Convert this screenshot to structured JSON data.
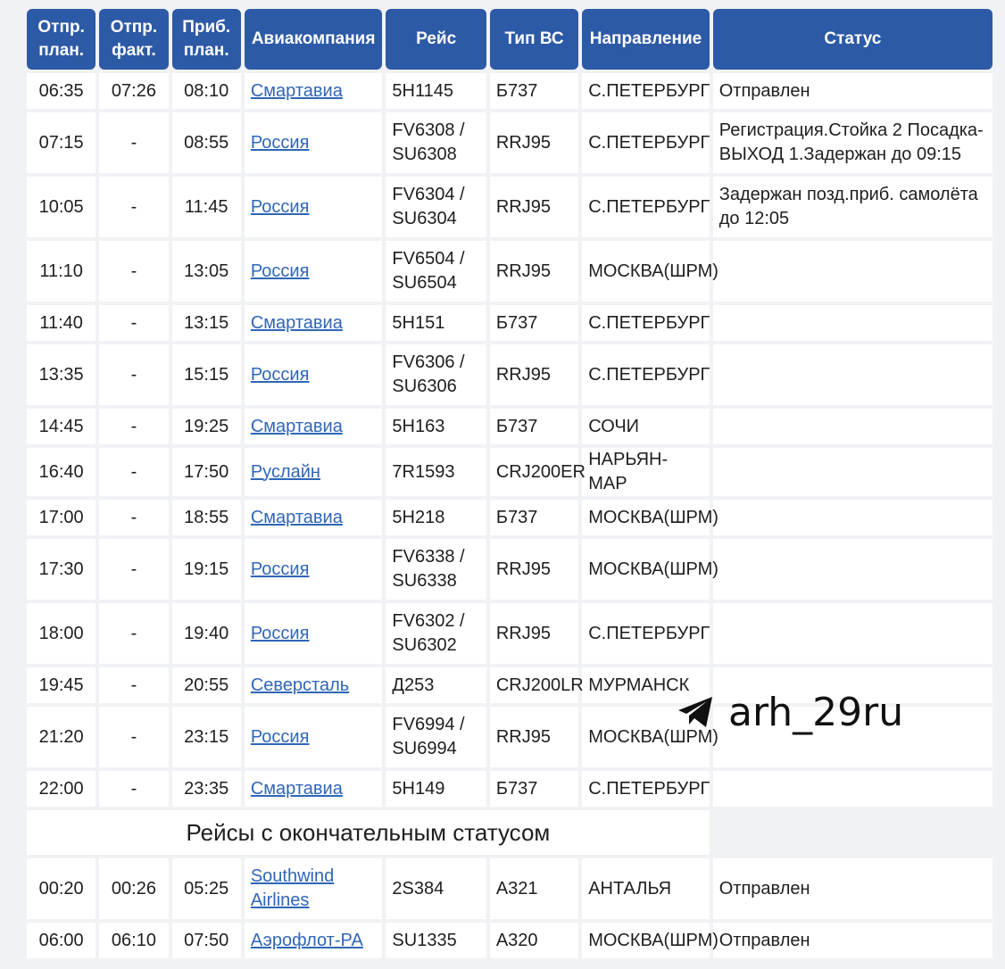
{
  "headers": {
    "dep_plan": "Отпр. план.",
    "dep_fact": "Отпр. факт.",
    "arr_plan": "Приб. план.",
    "airline": "Авиакомпания",
    "flight": "Рейс",
    "aircraft": "Тип ВС",
    "direction": "Направление",
    "status": "Статус"
  },
  "rows": [
    {
      "dep_plan": "06:35",
      "dep_fact": "07:26",
      "arr_plan": "08:10",
      "airline": "Смартавиа",
      "flight": "5Н1145",
      "aircraft": "Б737",
      "direction": "С.ПЕТЕРБУРГ",
      "status": "Отправлен"
    },
    {
      "dep_plan": "07:15",
      "dep_fact": "-",
      "arr_plan": "08:55",
      "airline": "Россия",
      "flight": "FV6308 / SU6308",
      "aircraft": "RRJ95",
      "direction": "С.ПЕТЕРБУРГ",
      "status": "Регистрация.Стойка 2 Посадка-ВЫХОД 1.Задержан до 09:15"
    },
    {
      "dep_plan": "10:05",
      "dep_fact": "-",
      "arr_plan": "11:45",
      "airline": "Россия",
      "flight": "FV6304 / SU6304",
      "aircraft": "RRJ95",
      "direction": "С.ПЕТЕРБУРГ",
      "status": "Задержан позд.приб. самолёта до 12:05"
    },
    {
      "dep_plan": "11:10",
      "dep_fact": "-",
      "arr_plan": "13:05",
      "airline": "Россия",
      "flight": "FV6504 / SU6504",
      "aircraft": "RRJ95",
      "direction": "МОСКВА(ШРМ)",
      "status": ""
    },
    {
      "dep_plan": "11:40",
      "dep_fact": "-",
      "arr_plan": "13:15",
      "airline": "Смартавиа",
      "flight": "5Н151",
      "aircraft": "Б737",
      "direction": "С.ПЕТЕРБУРГ",
      "status": ""
    },
    {
      "dep_plan": "13:35",
      "dep_fact": "-",
      "arr_plan": "15:15",
      "airline": "Россия",
      "flight": "FV6306 / SU6306",
      "aircraft": "RRJ95",
      "direction": "С.ПЕТЕРБУРГ",
      "status": ""
    },
    {
      "dep_plan": "14:45",
      "dep_fact": "-",
      "arr_plan": "19:25",
      "airline": "Смартавиа",
      "flight": "5Н163",
      "aircraft": "Б737",
      "direction": "СОЧИ",
      "status": ""
    },
    {
      "dep_plan": "16:40",
      "dep_fact": "-",
      "arr_plan": "17:50",
      "airline": "Руслайн",
      "flight": "7R1593",
      "aircraft": "CRJ200ER",
      "direction": "НАРЬЯН-МАР",
      "status": ""
    },
    {
      "dep_plan": "17:00",
      "dep_fact": "-",
      "arr_plan": "18:55",
      "airline": "Смартавиа",
      "flight": "5Н218",
      "aircraft": "Б737",
      "direction": "МОСКВА(ШРМ)",
      "status": ""
    },
    {
      "dep_plan": "17:30",
      "dep_fact": "-",
      "arr_plan": "19:15",
      "airline": "Россия",
      "flight": "FV6338 / SU6338",
      "aircraft": "RRJ95",
      "direction": "МОСКВА(ШРМ)",
      "status": ""
    },
    {
      "dep_plan": "18:00",
      "dep_fact": "-",
      "arr_plan": "19:40",
      "airline": "Россия",
      "flight": "FV6302 / SU6302",
      "aircraft": "RRJ95",
      "direction": "С.ПЕТЕРБУРГ",
      "status": ""
    },
    {
      "dep_plan": "19:45",
      "dep_fact": "-",
      "arr_plan": "20:55",
      "airline": "Северсталь",
      "flight": "Д253",
      "aircraft": "CRJ200LR",
      "direction": "МУРМАНСК",
      "status": ""
    },
    {
      "dep_plan": "21:20",
      "dep_fact": "-",
      "arr_plan": "23:15",
      "airline": "Россия",
      "flight": "FV6994 / SU6994",
      "aircraft": "RRJ95",
      "direction": "МОСКВА(ШРМ)",
      "status": ""
    },
    {
      "dep_plan": "22:00",
      "dep_fact": "-",
      "arr_plan": "23:35",
      "airline": "Смартавиа",
      "flight": "5Н149",
      "aircraft": "Б737",
      "direction": "С.ПЕТЕРБУРГ",
      "status": ""
    }
  ],
  "final_section": {
    "title": "Рейсы с окончательным статусом",
    "rows": [
      {
        "dep_plan": "00:20",
        "dep_fact": "00:26",
        "arr_plan": "05:25",
        "airline": "Southwind Airlines",
        "flight": "2S384",
        "aircraft": "А321",
        "direction": "АНТАЛЬЯ",
        "status": "Отправлен"
      },
      {
        "dep_plan": "06:00",
        "dep_fact": "06:10",
        "arr_plan": "07:50",
        "airline": "Аэрофлот-РА",
        "flight": "SU1335",
        "aircraft": "А320",
        "direction": "МОСКВА(ШРМ)",
        "status": "Отправлен"
      }
    ]
  },
  "watermark": {
    "text": "arh_29ru",
    "icon": "telegram-icon"
  },
  "colors": {
    "header_bg": "#2d5aa6",
    "link": "#2f66b7",
    "page_bg": "#f1f2f5"
  }
}
